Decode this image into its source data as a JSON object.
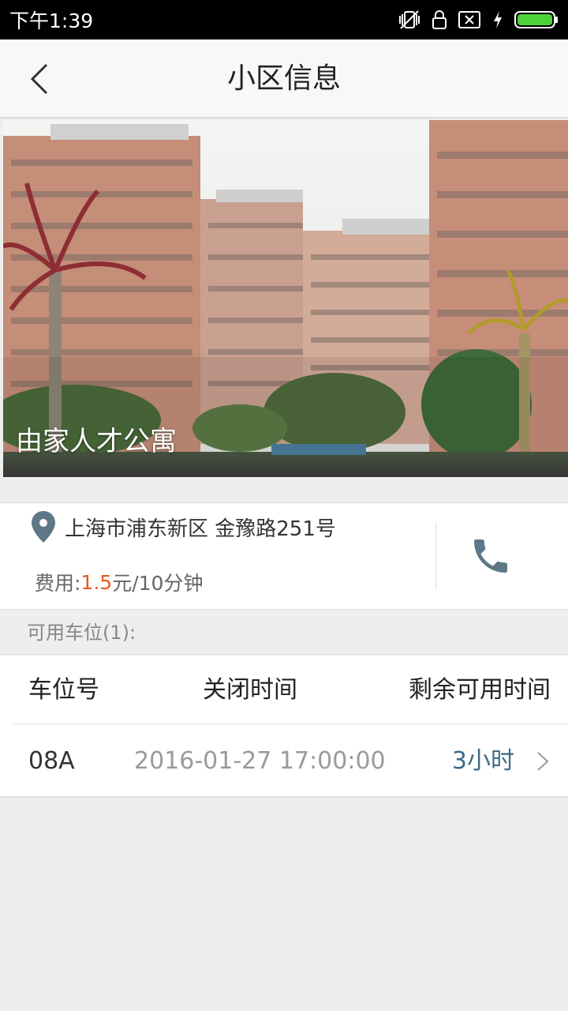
{
  "status_bar": {
    "time": "下午1:39",
    "icons": [
      "vibrate-off-icon",
      "lock-icon",
      "sim-x-icon",
      "charging-icon",
      "battery-icon"
    ]
  },
  "header": {
    "title": "小区信息",
    "back_icon": "back-chevron-icon"
  },
  "hero": {
    "name": "由家人才公寓"
  },
  "info": {
    "address": "上海市浦东新区 金豫路251号",
    "fee_label": "费用:",
    "fee_value": "1.5",
    "fee_unit": "元/10分钟",
    "location_icon": "location-pin-icon",
    "phone_icon": "phone-icon"
  },
  "available": {
    "label": "可用车位(1):"
  },
  "table": {
    "headers": [
      "车位号",
      "关闭时间",
      "剩余可用时间"
    ],
    "rows": [
      {
        "id": "08A",
        "close_time": "2016-01-27 17:00:00",
        "remaining": "3小时"
      }
    ]
  },
  "colors": {
    "accent": "#e8591f",
    "icon": "#5d7786",
    "remaining": "#3d6a88"
  }
}
